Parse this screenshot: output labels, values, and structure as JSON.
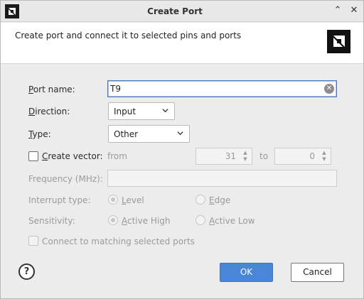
{
  "window": {
    "title": "Create Port",
    "minimize_glyph": "⌃",
    "close_glyph": "✕"
  },
  "header": {
    "description": "Create port and connect it to selected pins and ports",
    "logo_icon": "amd-logo-icon"
  },
  "form": {
    "port_name": {
      "label_underlined": "P",
      "label_rest": "ort name:",
      "value": "T9"
    },
    "direction": {
      "label_underlined": "D",
      "label_rest": "irection:",
      "value": "Input"
    },
    "type": {
      "label_underlined": "T",
      "label_rest": "ype:",
      "value": "Other"
    },
    "create_vector": {
      "label_underlined": "C",
      "label_rest": "reate vector:",
      "checked": false,
      "from_label": "from",
      "from_value": "31",
      "to_label": "to",
      "to_value": "0"
    },
    "frequency": {
      "label": "Frequency (MHz):",
      "value": ""
    },
    "interrupt_type": {
      "label": "Interrupt type:",
      "options": [
        {
          "underlined": "L",
          "rest": "evel",
          "selected": true
        },
        {
          "underlined": "E",
          "rest": "dge",
          "selected": false
        }
      ]
    },
    "sensitivity": {
      "label": "Sensitivity:",
      "options": [
        {
          "underlined": "A",
          "rest": "ctive High",
          "selected": true
        },
        {
          "underlined": "A",
          "rest": "ctive Low",
          "selected": false
        }
      ]
    },
    "connect_matching": {
      "label": "Connect to matching selected ports",
      "checked": false
    }
  },
  "footer": {
    "help_label": "?",
    "ok_label": "OK",
    "cancel_label": "Cancel"
  },
  "colors": {
    "accent": "#4a86d8",
    "disabled_text": "#9a9a9a"
  }
}
